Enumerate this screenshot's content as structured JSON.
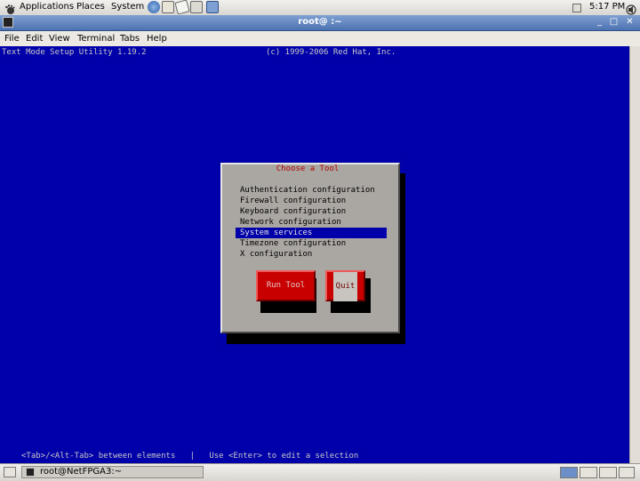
{
  "top_panel": {
    "applications": "Applications",
    "places": "Places",
    "system": "System",
    "launchers": [
      "browser-icon",
      "mail-icon",
      "notes-icon",
      "edit-icon",
      "screenshot-icon"
    ],
    "clock": "5:17 PM"
  },
  "window": {
    "title": "root@                    :~"
  },
  "menubar": {
    "items": [
      "File",
      "Edit",
      "View",
      "Terminal",
      "Tabs",
      "Help"
    ]
  },
  "terminal": {
    "header_left": "Text Mode Setup Utility 1.19.2",
    "header_right": "(c) 1999-2006 Red Hat, Inc.",
    "footer": "<Tab>/<Alt-Tab> between elements   |   Use <Enter> to edit a selection"
  },
  "dialog": {
    "title": "Choose a Tool",
    "items": [
      "Authentication configuration",
      "Firewall configuration",
      "Keyboard configuration",
      "Network configuration",
      "System services",
      "Timezone configuration",
      "X configuration"
    ],
    "selected_index": 4,
    "run_button": "Run Tool",
    "quit_button": "Quit"
  },
  "bottom_panel": {
    "task_label": "root@NetFPGA3:~"
  },
  "colors": {
    "terminal_bg": "#0000aa",
    "dialog_bg": "#aaa6a2",
    "button_red": "#c80000",
    "dialog_title": "#b00000",
    "titlebar": "#4d72b1"
  }
}
